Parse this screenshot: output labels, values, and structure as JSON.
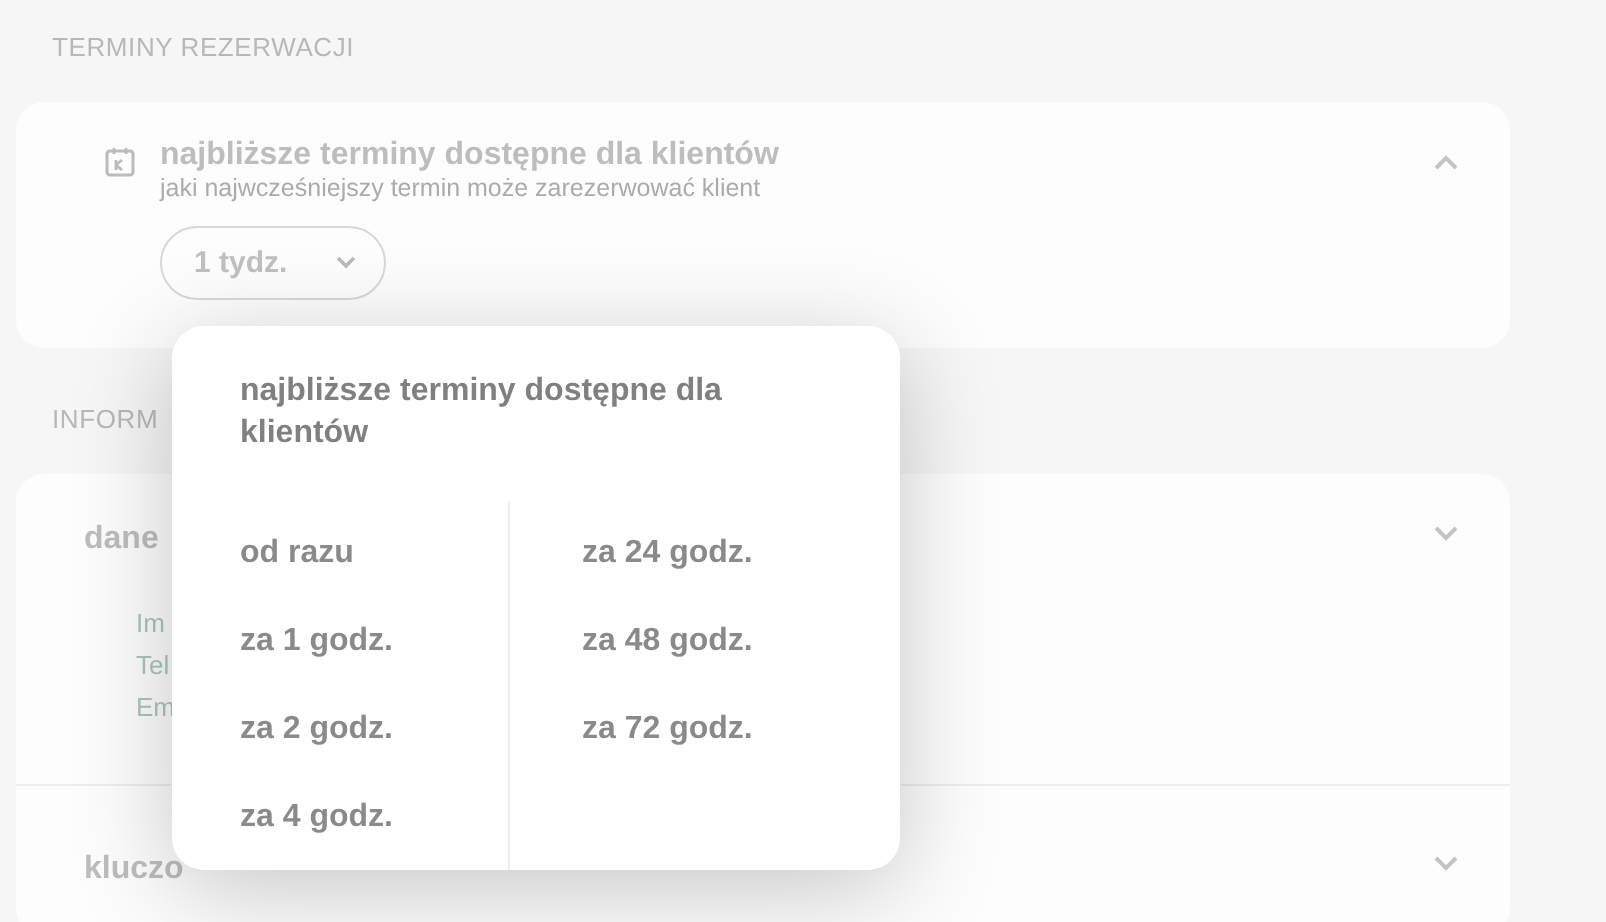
{
  "sections": [
    {
      "heading": "TERMINY REZERWACJI",
      "cards": [
        {
          "kind": "setting",
          "title": "najbliższe terminy dostępne dla klientów",
          "subtitle": "jaki najwcześniejszy termin może zarezerwować klient",
          "expanded": true,
          "dropdown": {
            "value": "1 tydz."
          }
        }
      ]
    },
    {
      "heading": "INFORM",
      "cards": [
        {
          "kind": "fields",
          "title": "dane",
          "expanded": false,
          "fields": [
            "Im",
            "Tel",
            "Em"
          ]
        },
        {
          "kind": "plain",
          "title": "kluczo",
          "expanded": false
        }
      ]
    }
  ],
  "popup": {
    "title": "najbliższe terminy dostępne dla klientów",
    "columns": [
      [
        {
          "label": "od razu",
          "selected": false
        },
        {
          "label": "za 1 godz.",
          "selected": false
        },
        {
          "label": "za 2 godz.",
          "selected": false
        },
        {
          "label": "za 4 godz.",
          "selected": false
        }
      ],
      [
        {
          "label": "za 24 godz.",
          "selected": false
        },
        {
          "label": "za 48 godz.",
          "selected": false
        },
        {
          "label": "za 72 godz.",
          "selected": false
        }
      ]
    ]
  }
}
